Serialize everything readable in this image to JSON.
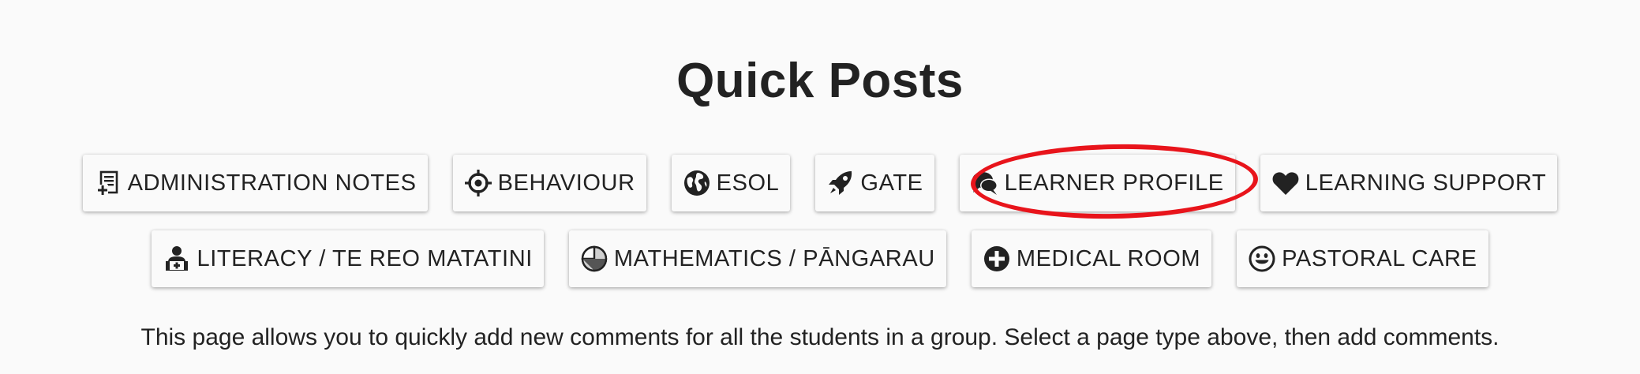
{
  "page": {
    "title": "Quick Posts",
    "description": "This page allows you to quickly add new comments for all the students in a group. Select a page type above, then add comments."
  },
  "buttons_row1": [
    {
      "label": "ADMINISTRATION NOTES",
      "icon": "admin-notes-icon"
    },
    {
      "label": "BEHAVIOUR",
      "icon": "crosshair-icon"
    },
    {
      "label": "ESOL",
      "icon": "globe-icon"
    },
    {
      "label": "GATE",
      "icon": "rocket-icon"
    },
    {
      "label": "LEARNER PROFILE",
      "icon": "speech-bubbles-icon"
    },
    {
      "label": "LEARNING SUPPORT",
      "icon": "heart-icon"
    }
  ],
  "buttons_row2": [
    {
      "label": "LITERACY / TE REO MATATINI",
      "icon": "reader-icon"
    },
    {
      "label": "MATHEMATICS / PĀNGARAU",
      "icon": "pie-chart-icon"
    },
    {
      "label": "MEDICAL ROOM",
      "icon": "plus-circle-icon"
    },
    {
      "label": "PASTORAL CARE",
      "icon": "smiley-icon"
    }
  ],
  "annotation": {
    "highlight_color": "#e8141b",
    "highlighted_button": "LEARNER PROFILE"
  }
}
